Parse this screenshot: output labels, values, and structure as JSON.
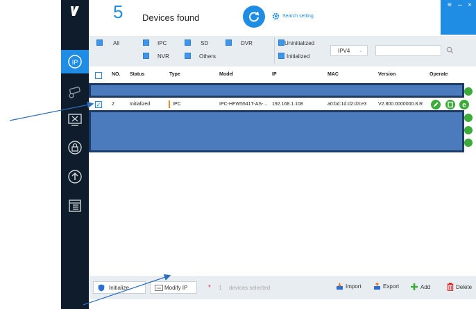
{
  "header": {
    "count": "5",
    "label": "Devices found",
    "search_setting": "Search setting"
  },
  "filters": {
    "all": "All",
    "ipc": "IPC",
    "sd": "SD",
    "dvr": "DVR",
    "nvr": "NVR",
    "others": "Others",
    "uninitialized": "Uninitialized",
    "initialized": "Initialized",
    "ip_version": "IPV4",
    "search_placeholder": ""
  },
  "table": {
    "columns": [
      "NO.",
      "Status",
      "Type",
      "Model",
      "IP",
      "MAC",
      "Version",
      "Operate"
    ],
    "rows": [
      {
        "no": "2",
        "status": "Initialized",
        "type": "IPC",
        "model": "IPC-HFW5541T-AS-...",
        "ip": "192.168.1.108",
        "mac": "a0:bd:1d:d2:d3:e3",
        "version": "V2.800.0000000.8.R",
        "checked": true
      }
    ]
  },
  "bottom": {
    "initialize": "Initialize",
    "modify_ip": "Modify IP",
    "selected_count": "1",
    "selected_text": "devices selected",
    "import": "Import",
    "export": "Export",
    "add": "Add",
    "delete": "Delete"
  },
  "colors": {
    "accent": "#1f8de4",
    "sidebar": "#0e1c2b",
    "mask": "#4b7bbd",
    "operate_green": "#3cab3a",
    "type_marker": "#f08a24"
  }
}
